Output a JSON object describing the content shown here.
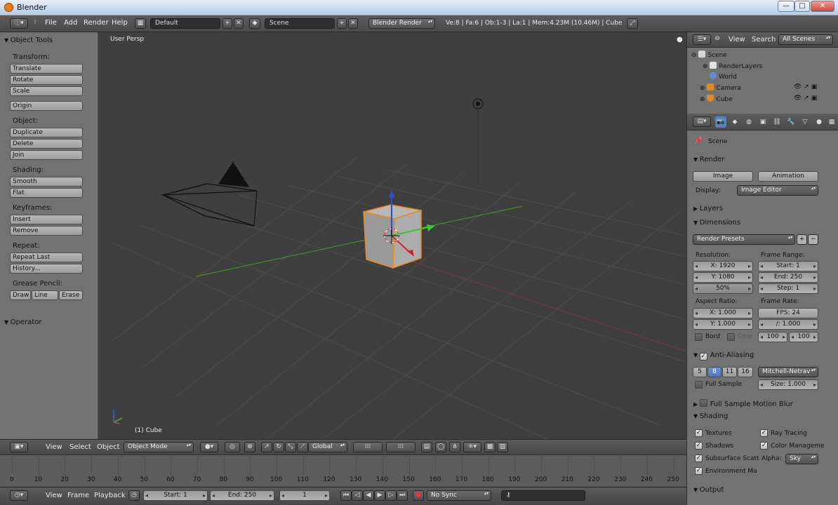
{
  "window": {
    "title": "Blender",
    "controls": [
      "—",
      "□",
      "✕"
    ]
  },
  "header": {
    "menus": [
      "File",
      "Add",
      "Render",
      "Help"
    ],
    "layout": "Default",
    "scene": "Scene",
    "engine": "Blender Render",
    "stats": "Ve:8 | Fa:6 | Ob:1-3 | La:1 | Mem:4.23M (10.46M) | Cube"
  },
  "toolshelf": {
    "title": "Object Tools",
    "transform_label": "Transform:",
    "translate": "Translate",
    "rotate": "Rotate",
    "scale": "Scale",
    "origin": "Origin",
    "object_label": "Object:",
    "duplicate": "Duplicate",
    "delete": "Delete",
    "join": "Join",
    "shading_label": "Shading:",
    "smooth": "Smooth",
    "flat": "Flat",
    "keyframes_label": "Keyframes:",
    "insert": "Insert",
    "remove": "Remove",
    "repeat_label": "Repeat:",
    "repeat_last": "Repeat Last",
    "history": "History...",
    "grease_label": "Grease Pencil:",
    "draw": "Draw",
    "line": "Line",
    "erase": "Erase",
    "operator": "Operator"
  },
  "viewport": {
    "view_name": "User Persp",
    "active_object": "(1) Cube"
  },
  "view3d_header": {
    "view": "View",
    "select": "Select",
    "object": "Object",
    "mode": "Object Mode",
    "orientation": "Global"
  },
  "timeline": {
    "ticks": [
      "0",
      "10",
      "20",
      "30",
      "40",
      "50",
      "60",
      "70",
      "80",
      "90",
      "100",
      "110",
      "120",
      "130",
      "140",
      "150",
      "160",
      "170",
      "180",
      "190",
      "200",
      "210",
      "220",
      "230",
      "240",
      "250"
    ],
    "current_frame_marker": "0"
  },
  "timeline_header": {
    "view": "View",
    "frame": "Frame",
    "playback": "Playback",
    "start": "Start: 1",
    "end": "End: 250",
    "current": "1",
    "sync": "No Sync"
  },
  "outliner": {
    "view": "View",
    "search": "Search",
    "filter": "All Scenes",
    "items": {
      "scene": "Scene",
      "renderlayers": "RenderLayers",
      "world": "World",
      "camera": "Camera",
      "cube": "Cube"
    }
  },
  "properties": {
    "context": "Scene",
    "render": {
      "title": "Render",
      "image": "Image",
      "animation": "Animation",
      "display_label": "Display:",
      "display_value": "Image Editor"
    },
    "layers": "Layers",
    "dimensions": {
      "title": "Dimensions",
      "presets": "Render Presets",
      "resolution_label": "Resolution:",
      "res_x": "X: 1920",
      "res_y": "Y: 1080",
      "res_pct": "50%",
      "frame_range_label": "Frame Range:",
      "start": "Start: 1",
      "end": "End: 250",
      "step": "Step: 1",
      "aspect_label": "Aspect Ratio:",
      "asp_x": "X: 1.000",
      "asp_y": "Y: 1.000",
      "frame_rate_label": "Frame Rate:",
      "fps": "FPS: 24",
      "fps_base": "/: 1.000",
      "old": "100",
      "new": "100",
      "bord": "Bord",
      "crop": "Crop"
    },
    "anti_aliasing": {
      "title": "Anti-Aliasing",
      "samples": [
        "5",
        "8",
        "11",
        "16"
      ],
      "selected": "8",
      "filter": "Mitchell-Netrav",
      "full_sample": "Full Sample",
      "size": "Size: 1.000"
    },
    "motion_blur": "Full Sample Motion Blur",
    "shading": {
      "title": "Shading",
      "textures": "Textures",
      "ray_tracing": "Ray Tracing",
      "shadows": "Shadows",
      "color_management": "Color Manageme",
      "subsurface": "Subsurface Scatt",
      "alpha_label": "Alpha:",
      "alpha_value": "Sky",
      "env_map": "Environment Ma"
    },
    "output": "Output"
  }
}
